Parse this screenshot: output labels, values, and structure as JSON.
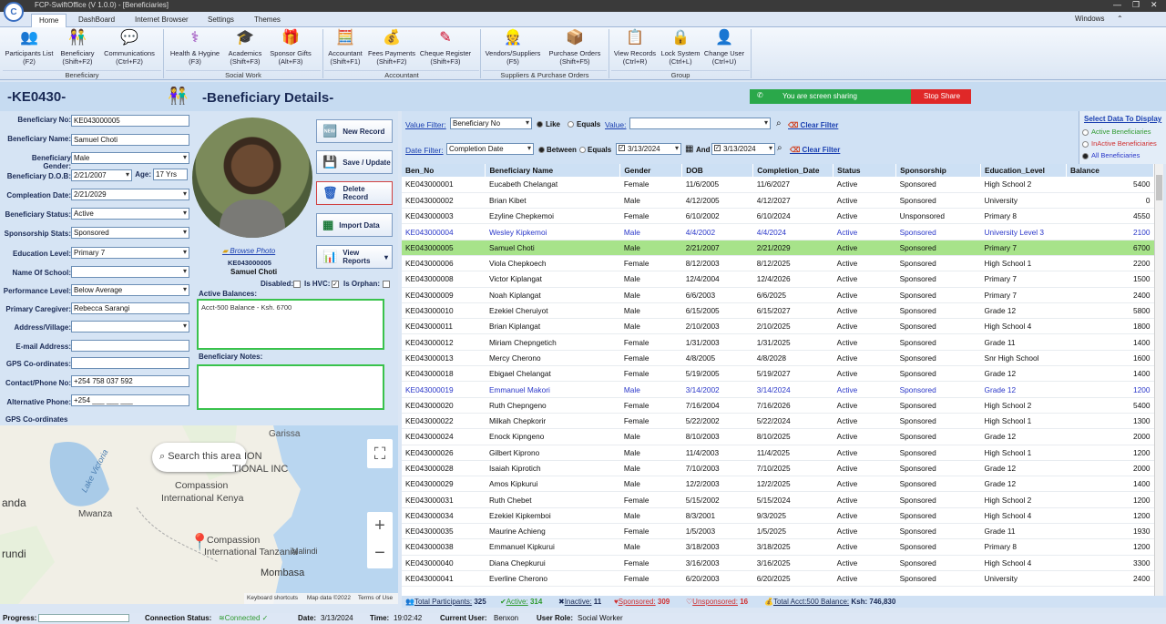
{
  "window": {
    "title": "FCP-SwiftOffice (V 1.0.0) - [Beneficiaries]",
    "theme": "Windows"
  },
  "tabs": [
    "Home",
    "DashBoard",
    "Internet Browser",
    "Settings",
    "Themes"
  ],
  "ribbon": {
    "buttons": [
      {
        "label": "Participants List",
        "key": "(F2)",
        "icon": "people-icon"
      },
      {
        "label": "Beneficiary",
        "key": "(Shift+F2)",
        "icon": "children-icon"
      },
      {
        "label": "Communications",
        "key": "(Ctrl+F2)",
        "icon": "chat-icon"
      },
      {
        "label": "Health & Hygine",
        "key": "(F3)",
        "icon": "stethoscope-icon"
      },
      {
        "label": "Academics",
        "key": "(Shift+F3)",
        "icon": "graduation-cap-icon"
      },
      {
        "label": "Sponsor Gifts",
        "key": "(Alt+F3)",
        "icon": "gift-icon"
      },
      {
        "label": "Accountant",
        "key": "(Shift+F1)",
        "icon": "calculator-icon"
      },
      {
        "label": "Fees Payments",
        "key": "(Shift+F2)",
        "icon": "coins-icon"
      },
      {
        "label": "Cheque Register",
        "key": "(Shift+F3)",
        "icon": "pen-icon"
      },
      {
        "label": "Vendors/Suppliers",
        "key": "(F5)",
        "icon": "vendor-icon"
      },
      {
        "label": "Purchase Orders",
        "key": "(Shift+F5)",
        "icon": "orders-icon"
      },
      {
        "label": "View Records",
        "key": "(Ctrl+R)",
        "icon": "records-icon"
      },
      {
        "label": "Lock System",
        "key": "(Ctrl+L)",
        "icon": "lock-icon"
      },
      {
        "label": "Change User",
        "key": "(Ctrl+U)",
        "icon": "user-icon"
      }
    ],
    "groups": [
      "Beneficiary",
      "Social Work",
      "Accountant",
      "Suppliers & Purchase Orders",
      "Group"
    ]
  },
  "header": {
    "code": "-KE0430-",
    "title": "-Beneficiary Details-"
  },
  "sharing": {
    "text": "You are screen sharing",
    "stop": "Stop Share"
  },
  "form": {
    "labels": {
      "no": "Beneficiary No:",
      "name": "Beneficiary Name:",
      "gender": "Beneficiary Gender:",
      "dob": "Beneficiary D.O.B:",
      "age": "Age:",
      "comp": "Compleation Date:",
      "status": "Beneficiary Status:",
      "sponsor": "Sponsorship  Stats:",
      "edu": "Education Level:",
      "school": "Name Of School:",
      "perf": "Performance Level:",
      "caregiver": "Primary Caregiver:",
      "address": "Address/Village:",
      "email": "E-mail Address:",
      "gps": "GPS Co-ordinates:",
      "phone": "Contact/Phone No:",
      "alt": "Alternative Phone:"
    },
    "values": {
      "no": "KE043000005",
      "name": "Samuel Choti",
      "gender": "Male",
      "dob": "2/21/2007",
      "age": "17 Yrs",
      "comp": "2/21/2029",
      "status": "Active",
      "sponsor": "Sponsored",
      "edu": "Primary 7",
      "school": "",
      "perf": "Below Average",
      "caregiver": "Rebecca Sarangi",
      "address": "",
      "email": "",
      "gps": "",
      "phone": "+254 758 037 592",
      "alt": "+254 ___ ___ ___"
    },
    "buttons": {
      "new": "New Record",
      "save": "Save / Update",
      "delete": "Delete Record",
      "import": "Import Data",
      "reports": "View Reports"
    },
    "photo": {
      "browse": "Browse Photo",
      "id": "KE043000005",
      "name": "Samuel Choti"
    },
    "flags": {
      "disabled": "Disabled:",
      "hvc": "Is HVC:",
      "orphan": "Is Orphan:"
    },
    "balances_label": "Active Balances:",
    "balances_text": "Acct-500 Balance   -   Ksh. 6700",
    "notes_label": "Beneficiary Notes:",
    "gps_label": "GPS Co-ordinates"
  },
  "map": {
    "search": "Search this area",
    "places": [
      "Garissa",
      "ION",
      "TIONAL INC",
      "Compassion",
      "International Kenya",
      "Lake Victoria",
      "anda",
      "Mwanza",
      "rundi",
      "Compassion",
      "International Tanzania",
      "Malindi",
      "Mombasa"
    ],
    "footer": [
      "Keyboard shortcuts",
      "Map data ©2022",
      "Terms of Use"
    ]
  },
  "filters": {
    "value_label": "Value Filter:",
    "value_field": "Beneficiary No",
    "like": "Like",
    "equals": "Equals",
    "value": "Value:",
    "clear": "Clear Filter",
    "date_label": "Date Filter:",
    "date_field": "Completion Date",
    "between": "Between",
    "equals2": "Equals",
    "from": "3/13/2024",
    "and": "And",
    "to": "3/13/2024",
    "clear2": "Clear Filter"
  },
  "display": {
    "title": "Select Data To Display",
    "opts": [
      "Active Beneficiaries",
      "InActive Beneficiaries",
      "All Beneficiaries"
    ],
    "colors": [
      "#2f9a2f",
      "#d03030",
      "#2a37c9"
    ]
  },
  "grid": {
    "columns": [
      "Ben_No",
      "Beneficiary Name",
      "Gender",
      "DOB",
      "Completion_Date",
      "Status",
      "Sponsorship",
      "Education_Level",
      "Balance"
    ],
    "rows": [
      [
        "KE043000001",
        "Eucabeth Chelangat",
        "Female",
        "11/6/2005",
        "11/6/2027",
        "Active",
        "Sponsored",
        "High School 2",
        "5400"
      ],
      [
        "KE043000002",
        "Brian Kibet",
        "Male",
        "4/12/2005",
        "4/12/2027",
        "Active",
        "Sponsored",
        "University",
        "0"
      ],
      [
        "KE043000003",
        "Ezyline Chepkemoi",
        "Female",
        "6/10/2002",
        "6/10/2024",
        "Active",
        "Unsponsored",
        "Primary 8",
        "4550"
      ],
      [
        "KE043000004",
        "Wesley Kipkemoi",
        "Male",
        "4/4/2002",
        "4/4/2024",
        "Active",
        "Sponsored",
        "University Level 3",
        "2100"
      ],
      [
        "KE043000005",
        "Samuel Choti",
        "Male",
        "2/21/2007",
        "2/21/2029",
        "Active",
        "Sponsored",
        "Primary 7",
        "6700"
      ],
      [
        "KE043000006",
        "Viola Chepkoech",
        "Female",
        "8/12/2003",
        "8/12/2025",
        "Active",
        "Sponsored",
        "High School 1",
        "2200"
      ],
      [
        "KE043000008",
        "Victor Kiplangat",
        "Male",
        "12/4/2004",
        "12/4/2026",
        "Active",
        "Sponsored",
        "Primary 7",
        "1500"
      ],
      [
        "KE043000009",
        "Noah Kiplangat",
        "Male",
        "6/6/2003",
        "6/6/2025",
        "Active",
        "Sponsored",
        "Primary 7",
        "2400"
      ],
      [
        "KE043000010",
        "Ezekiel Cheruiyot",
        "Male",
        "6/15/2005",
        "6/15/2027",
        "Active",
        "Sponsored",
        "Grade 12",
        "5800"
      ],
      [
        "KE043000011",
        "Brian Kiplangat",
        "Male",
        "2/10/2003",
        "2/10/2025",
        "Active",
        "Sponsored",
        "High School 4",
        "1800"
      ],
      [
        "KE043000012",
        "Miriam Chepngetich",
        "Female",
        "1/31/2003",
        "1/31/2025",
        "Active",
        "Sponsored",
        "Grade 11",
        "1400"
      ],
      [
        "KE043000013",
        "Mercy Cherono",
        "Female",
        "4/8/2005",
        "4/8/2028",
        "Active",
        "Sponsored",
        "Snr High School",
        "1600"
      ],
      [
        "KE043000018",
        "Ebigael Chelangat",
        "Female",
        "5/19/2005",
        "5/19/2027",
        "Active",
        "Sponsored",
        "Grade 12",
        "1400"
      ],
      [
        "KE043000019",
        "Emmanuel Makori",
        "Male",
        "3/14/2002",
        "3/14/2024",
        "Active",
        "Sponsored",
        "Grade 12",
        "1200"
      ],
      [
        "KE043000020",
        "Ruth Chepngeno",
        "Female",
        "7/16/2004",
        "7/16/2026",
        "Active",
        "Sponsored",
        "High School 2",
        "5400"
      ],
      [
        "KE043000022",
        "Milkah Chepkorir",
        "Female",
        "5/22/2002",
        "5/22/2024",
        "Active",
        "Sponsored",
        "High School 1",
        "1300"
      ],
      [
        "KE043000024",
        "Enock Kipngeno",
        "Male",
        "8/10/2003",
        "8/10/2025",
        "Active",
        "Sponsored",
        "Grade 12",
        "2000"
      ],
      [
        "KE043000026",
        "Gilbert Kiprono",
        "Male",
        "11/4/2003",
        "11/4/2025",
        "Active",
        "Sponsored",
        "High School 1",
        "1200"
      ],
      [
        "KE043000028",
        "Isaiah Kiprotich",
        "Male",
        "7/10/2003",
        "7/10/2025",
        "Active",
        "Sponsored",
        "Grade 12",
        "2000"
      ],
      [
        "KE043000029",
        "Amos Kipkurui",
        "Male",
        "12/2/2003",
        "12/2/2025",
        "Active",
        "Sponsored",
        "Grade 12",
        "1400"
      ],
      [
        "KE043000031",
        "Ruth Chebet",
        "Female",
        "5/15/2002",
        "5/15/2024",
        "Active",
        "Sponsored",
        "High School 2",
        "1200"
      ],
      [
        "KE043000034",
        "Ezekiel Kipkemboi",
        "Male",
        "8/3/2001",
        "9/3/2025",
        "Active",
        "Sponsored",
        "High School 4",
        "1200"
      ],
      [
        "KE043000035",
        "Maurine Achieng",
        "Female",
        "1/5/2003",
        "1/5/2025",
        "Active",
        "Sponsored",
        "Grade 11",
        "1930"
      ],
      [
        "KE043000038",
        "Emmanuel Kipkurui",
        "Male",
        "3/18/2003",
        "3/18/2025",
        "Active",
        "Sponsored",
        "Primary 8",
        "1200"
      ],
      [
        "KE043000040",
        "Diana Chepkurui",
        "Female",
        "3/16/2003",
        "3/16/2025",
        "Active",
        "Sponsored",
        "High School 4",
        "3300"
      ],
      [
        "KE043000041",
        "Everline Cherono",
        "Female",
        "6/20/2003",
        "6/20/2025",
        "Active",
        "Sponsored",
        "University",
        "2400"
      ]
    ],
    "selected_index": 4,
    "blue_indices": [
      3,
      13
    ]
  },
  "totals": {
    "participants_l": "Total Participants:",
    "participants": "325",
    "active_l": "Active:",
    "active": "314",
    "inactive_l": "Inactive:",
    "inactive": "11",
    "sponsored_l": "Sponsored:",
    "sponsored": "309",
    "unsponsored_l": "Unsponsored:",
    "unsponsored": "16",
    "acct_l": "Total Acct:500 Balance:",
    "acct": "Ksh: 746,830"
  },
  "status": {
    "progress": "Progress:",
    "conn_l": "Connection Status:",
    "conn": "Connected",
    "date_l": "Date:",
    "date": "3/13/2024",
    "time_l": "Time:",
    "time": "19:02:42",
    "user_l": "Current User:",
    "user": "Benxon",
    "role_l": "User Role:",
    "role": "Social Worker"
  }
}
